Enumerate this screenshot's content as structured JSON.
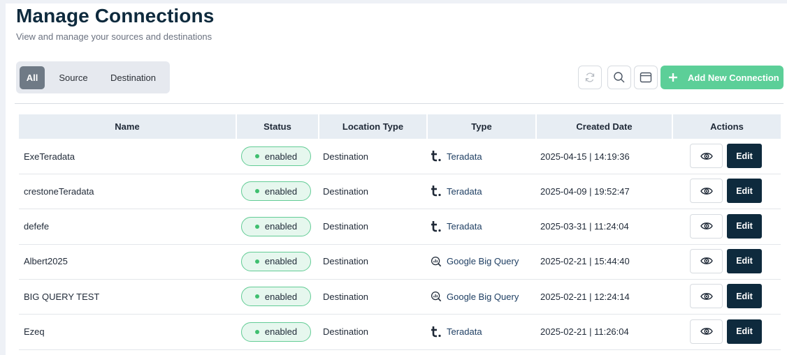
{
  "header": {
    "title": "Manage Connections",
    "subtitle": "View and manage your sources and destinations"
  },
  "filters": {
    "items": [
      {
        "label": "All",
        "active": true
      },
      {
        "label": "Source",
        "active": false
      },
      {
        "label": "Destination",
        "active": false
      }
    ]
  },
  "toolbar": {
    "refresh_icon": "refresh-icon",
    "search_icon": "search-icon",
    "layout_icon": "window-icon",
    "add_label": "Add New Connection"
  },
  "table": {
    "columns": [
      "Name",
      "Status",
      "Location Type",
      "Type",
      "Created Date",
      "Actions"
    ],
    "rows": [
      {
        "name": "ExeTeradata",
        "status": "enabled",
        "location_type": "Destination",
        "type": "Teradata",
        "type_icon": "teradata-logo",
        "created": "2025-04-15 | 14:19:36",
        "edit_label": "Edit"
      },
      {
        "name": "crestoneTeradata",
        "status": "enabled",
        "location_type": "Destination",
        "type": "Teradata",
        "type_icon": "teradata-logo",
        "created": "2025-04-09 | 19:52:47",
        "edit_label": "Edit"
      },
      {
        "name": "defefe",
        "status": "enabled",
        "location_type": "Destination",
        "type": "Teradata",
        "type_icon": "teradata-logo",
        "created": "2025-03-31 | 11:24:04",
        "edit_label": "Edit"
      },
      {
        "name": "Albert2025",
        "status": "enabled",
        "location_type": "Destination",
        "type": "Google Big Query",
        "type_icon": "bigquery-logo",
        "created": "2025-02-21 | 15:44:40",
        "edit_label": "Edit"
      },
      {
        "name": "BIG QUERY TEST",
        "status": "enabled",
        "location_type": "Destination",
        "type": "Google Big Query",
        "type_icon": "bigquery-logo",
        "created": "2025-02-21 | 12:24:14",
        "edit_label": "Edit"
      },
      {
        "name": "Ezeq",
        "status": "enabled",
        "location_type": "Destination",
        "type": "Teradata",
        "type_icon": "teradata-logo",
        "created": "2025-02-21 | 11:26:04",
        "edit_label": "Edit"
      }
    ]
  },
  "colors": {
    "brand_dark": "#0e2a3d",
    "accent_green": "#5ccf98",
    "status_green": "#3fbf6f",
    "header_bg": "#e7edf3"
  }
}
